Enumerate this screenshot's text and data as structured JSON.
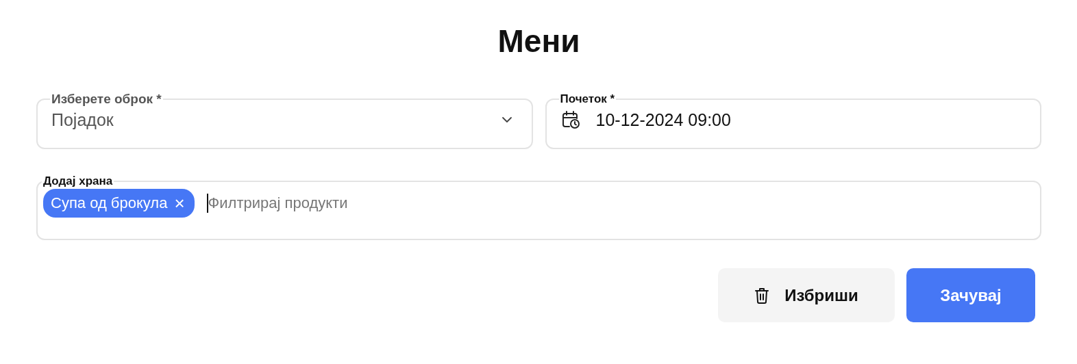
{
  "title": "Мени",
  "meal_select": {
    "label": "Изберете оброк *",
    "value": "Појадок"
  },
  "start": {
    "label": "Почеток *",
    "value": "10-12-2024 09:00"
  },
  "foods": {
    "label": "Додај храна",
    "chips": [
      {
        "label": "Супа од брокула",
        "remove": "×"
      }
    ],
    "placeholder": "Филтрирај продукти",
    "focused": true
  },
  "buttons": [
    {
      "kind": "delete",
      "label": "Избриши"
    },
    {
      "kind": "save",
      "label": "Зачувај"
    }
  ]
}
